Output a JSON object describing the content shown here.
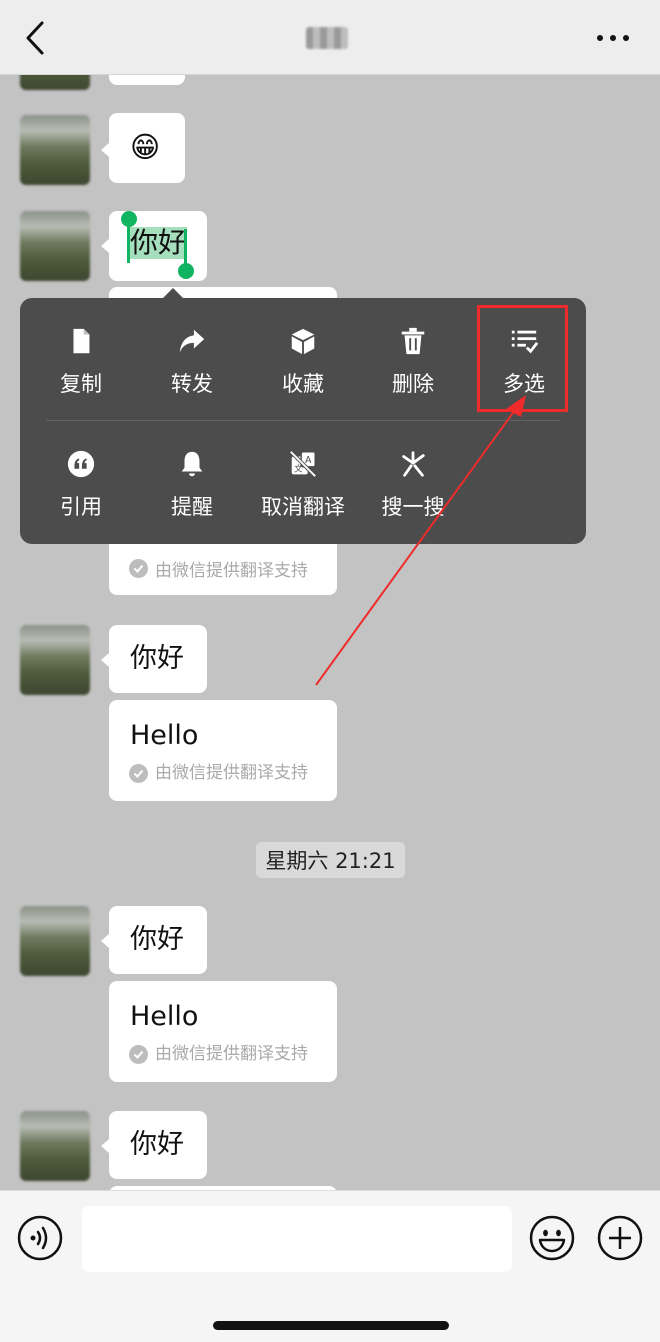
{
  "menu": {
    "row1": [
      {
        "label": "复制",
        "icon": "copy-icon"
      },
      {
        "label": "转发",
        "icon": "forward-icon"
      },
      {
        "label": "收藏",
        "icon": "favorite-icon"
      },
      {
        "label": "删除",
        "icon": "delete-icon"
      },
      {
        "label": "多选",
        "icon": "multi-select-icon"
      }
    ],
    "row2": [
      {
        "label": "引用",
        "icon": "quote-icon"
      },
      {
        "label": "提醒",
        "icon": "remind-icon"
      },
      {
        "label": "取消翻译",
        "icon": "translate-icon"
      },
      {
        "label": "搜一搜",
        "icon": "search-icon"
      }
    ]
  },
  "messages": [
    {
      "text": "😁"
    },
    {
      "text": "你好",
      "selected": true
    },
    {
      "text": "你好",
      "translation": "Hello",
      "note": "由微信提供翻译支持"
    },
    {
      "text": "你好",
      "translation": "Hello",
      "note": "由微信提供翻译支持"
    },
    {
      "text": "你好"
    }
  ],
  "hidden_note": "由微信提供翻译支持",
  "timestamp": "星期六 21:21",
  "colors": {
    "selection": "#a5dfbd",
    "handle": "#11b461",
    "menu_bg": "#4c4c4c",
    "highlight": "#ef2b2b"
  }
}
